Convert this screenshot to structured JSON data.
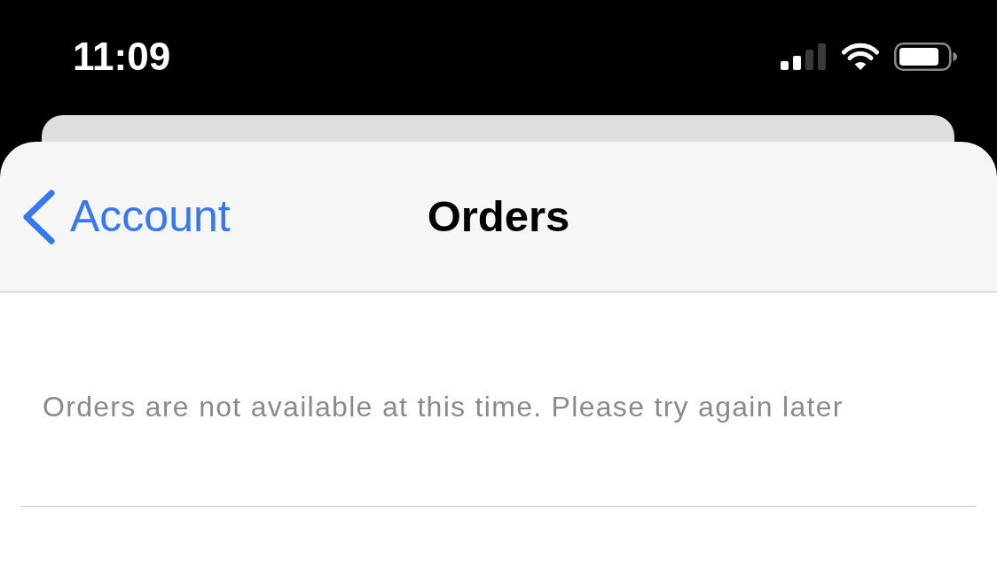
{
  "status_bar": {
    "time": "11:09"
  },
  "nav_bar": {
    "back_label": "Account",
    "title": "Orders"
  },
  "content": {
    "message": "Orders are not available at this time. Please try again later"
  }
}
